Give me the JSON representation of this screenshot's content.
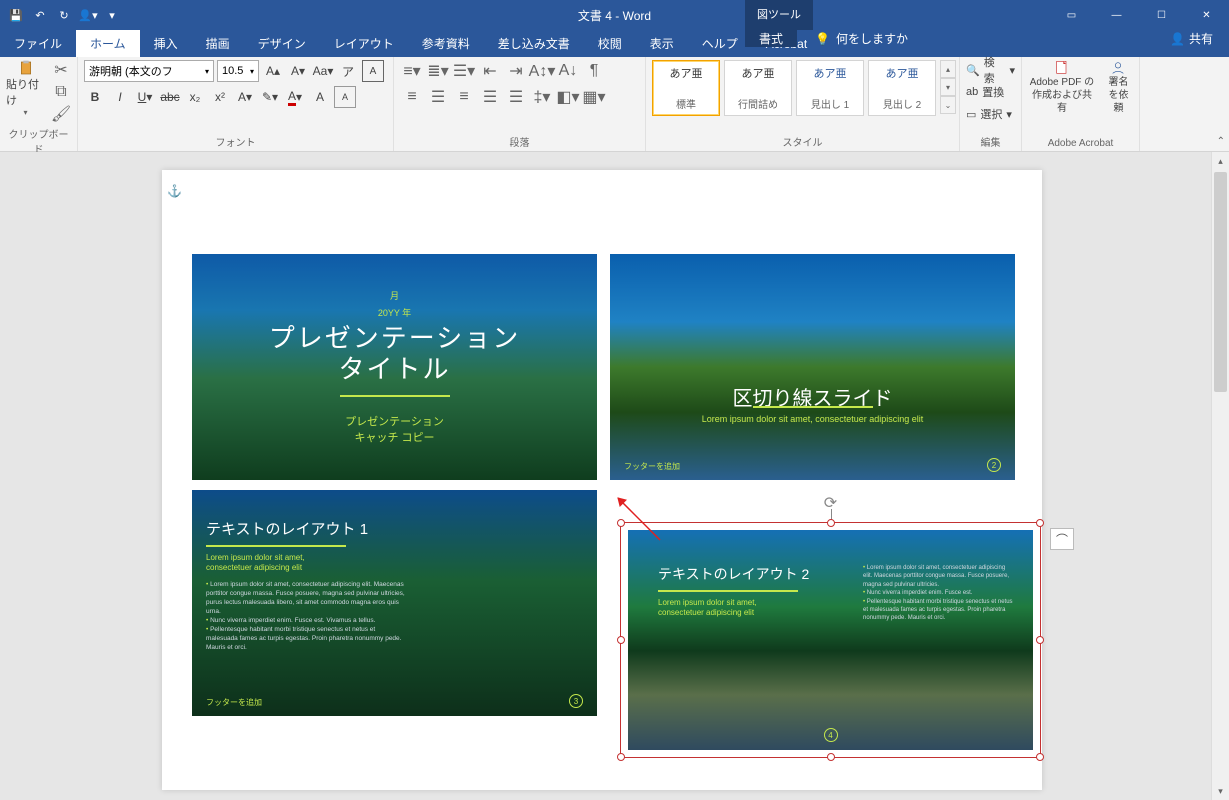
{
  "titlebar": {
    "title": "文書 4  -  Word",
    "tool_tab": "図ツール"
  },
  "tabs": {
    "file": "ファイル",
    "home": "ホーム",
    "insert": "挿入",
    "draw": "描画",
    "design": "デザイン",
    "layout": "レイアウト",
    "references": "参考資料",
    "mailings": "差し込み文書",
    "review": "校閲",
    "view": "表示",
    "help": "ヘルプ",
    "acrobat": "Acrobat",
    "format": "書式",
    "tell_me": "何をしますか",
    "share": "共有"
  },
  "ribbon": {
    "clipboard": {
      "label": "クリップボード",
      "paste": "貼り付け"
    },
    "font": {
      "label": "フォント",
      "name": "游明朝 (本文のフ",
      "size": "10.5"
    },
    "paragraph": {
      "label": "段落"
    },
    "styles": {
      "label": "スタイル",
      "sample": "あア亜",
      "items": [
        "標準",
        "行間詰め",
        "見出し 1",
        "見出し 2"
      ]
    },
    "editing": {
      "label": "編集",
      "find": "検索",
      "replace": "置換",
      "select": "選択"
    },
    "acrobat_group": {
      "label": "Adobe Acrobat",
      "create": "Adobe PDF の\n作成および共有",
      "sign": "署名\nを依頼"
    }
  },
  "slides": {
    "s1": {
      "date_month": "月",
      "date_year": "20YY 年",
      "title": "プレゼンテーション\nタイトル",
      "subtitle": "プレゼンテーション\nキャッチ コピー"
    },
    "s2": {
      "title": "区切り線スライド",
      "subtitle": "Lorem ipsum dolor sit amet, consectetuer adipiscing elit",
      "footer": "フッターを追加",
      "page": "2"
    },
    "s3": {
      "title": "テキストのレイアウト 1",
      "subtitle": "Lorem ipsum dolor sit amet,\nconsectetuer adipiscing elit",
      "bullets": [
        "Lorem ipsum dolor sit amet, consectetuer adipiscing elit. Maecenas porttitor congue massa. Fusce posuere, magna sed pulvinar ultricies, purus lectus malesuada libero, sit amet commodo magna eros quis urna.",
        "Nunc viverra imperdiet enim. Fusce est. Vivamus a tellus.",
        "Pellentesque habitant morbi tristique senectus et netus et malesuada fames ac turpis egestas. Proin pharetra nonummy pede. Mauris et orci."
      ],
      "footer": "フッターを追加",
      "page": "3"
    },
    "s4": {
      "title": "テキストのレイアウト 2",
      "subtitle": "Lorem ipsum dolor sit amet,\nconsectetuer adipiscing elit",
      "bullets": [
        "Lorem ipsum dolor sit amet, consectetuer adipiscing elit. Maecenas porttitor congue massa. Fusce posuere, magna sed pulvinar ultricies.",
        "Nunc viverra imperdiet enim. Fusce est.",
        "Pellentesque habitant morbi tristique senectus et netus et malesuada fames ac turpis egestas. Proin pharetra nonummy pede. Mauris et orci."
      ],
      "page": "4"
    }
  }
}
